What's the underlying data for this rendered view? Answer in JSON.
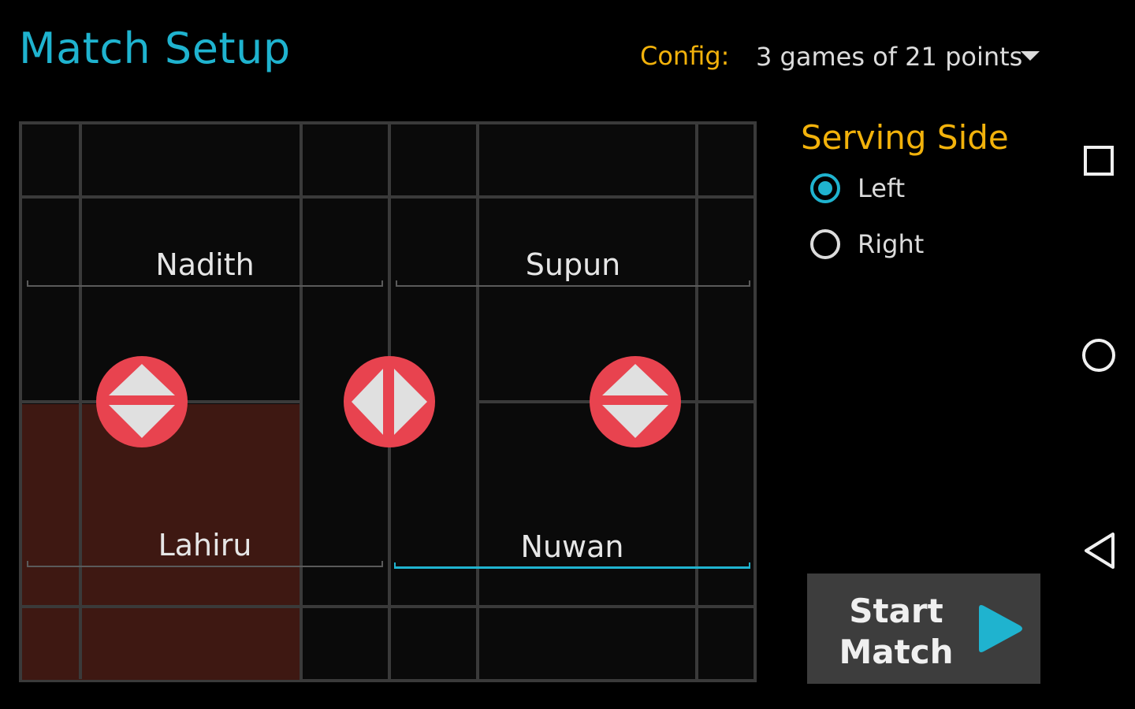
{
  "header": {
    "title": "Match Setup",
    "config_label": "Config:",
    "config_value": "3 games of 21 points"
  },
  "court": {
    "players": {
      "top_left": "Nadith",
      "top_right": "Supun",
      "bottom_left": "Lahiru",
      "bottom_right": "Nuwan"
    }
  },
  "serving": {
    "title": "Serving Side",
    "options": [
      {
        "label": "Left",
        "checked": true
      },
      {
        "label": "Right",
        "checked": false
      }
    ]
  },
  "start": {
    "line1": "Start",
    "line2": "Match"
  },
  "nav": {
    "icons": [
      "recents-square-icon",
      "home-circle-icon",
      "back-triangle-icon"
    ]
  },
  "colors": {
    "accent": "#1fb3cf",
    "label": "#f2b20b",
    "swap": "#e8434f",
    "highlight": "#3e1812"
  }
}
